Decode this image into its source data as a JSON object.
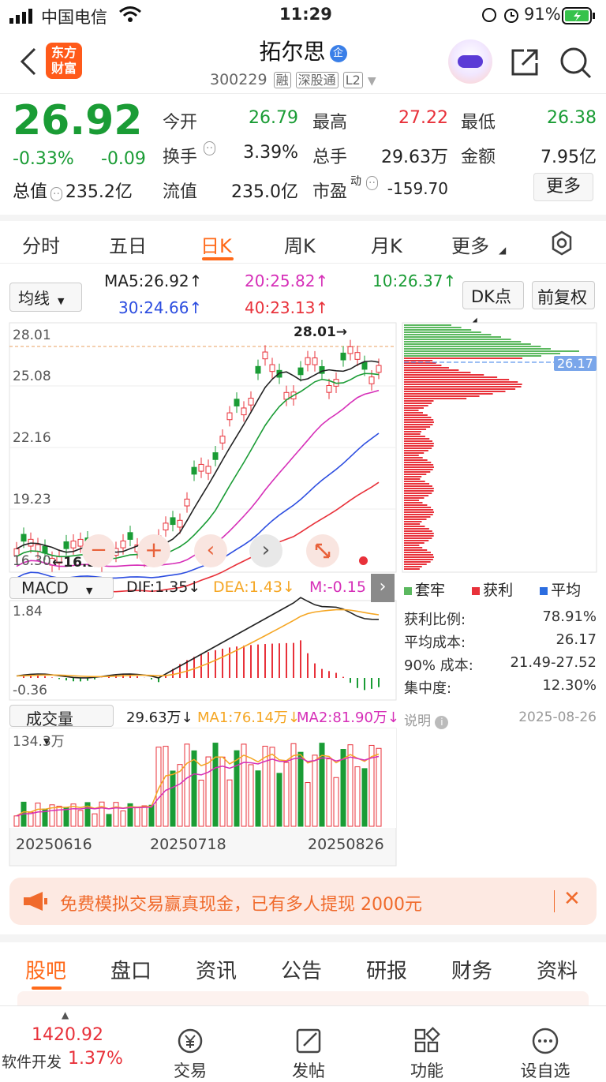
{
  "status": {
    "carrier": "中国电信",
    "time": "11:29",
    "battery": "91%"
  },
  "header": {
    "logo_line1": "东方",
    "logo_line2": "财富",
    "title": "拓尔思",
    "title_badge": "企",
    "code": "300229",
    "tags": [
      "融",
      "深股通",
      "L2"
    ]
  },
  "quote": {
    "price": "26.92",
    "pct": "-0.33%",
    "chg": "-0.09",
    "open_label": "今开",
    "open": "26.79",
    "high_label": "最高",
    "high": "27.22",
    "low_label": "最低",
    "low": "26.38",
    "turnover_label": "换手",
    "turnover": "3.39%",
    "vol_label": "总手",
    "vol": "29.63万",
    "amount_label": "金额",
    "amount": "7.95亿",
    "mcap_label": "总值",
    "mcap": "235.2亿",
    "float_label": "流值",
    "float": "235.0亿",
    "pe_label": "市盈",
    "pe_sup": "动",
    "pe": "-159.70",
    "more": "更多"
  },
  "tabs": [
    "分时",
    "五日",
    "日K",
    "周K",
    "月K",
    "更多"
  ],
  "ma": {
    "selector": "均线",
    "ma5": "MA5:26.92↑",
    "ma10": "10:26.37↑",
    "ma20": "20:25.82↑",
    "ma30": "30:24.66↑",
    "ma40": "40:23.13↑",
    "dk": "DK点",
    "adj": "前复权"
  },
  "kchart": {
    "y_labels": [
      "28.01",
      "25.08",
      "22.16",
      "19.23",
      "16.30"
    ],
    "max_label": "28.01→",
    "min_label": "←16.30"
  },
  "chip": {
    "cost_tag": "26.17",
    "legend": [
      "套牢",
      "获利",
      "平均"
    ],
    "rows": [
      {
        "k": "获利比例:",
        "v": "78.91%"
      },
      {
        "k": "平均成本:",
        "v": "26.17"
      },
      {
        "k": "90% 成本:",
        "v": "21.49-27.52"
      },
      {
        "k": "集中度:",
        "v": "12.30%"
      }
    ],
    "note": "说明",
    "date": "2025-08-26"
  },
  "macd": {
    "selector": "MACD",
    "dif": "DIF:1.35↓",
    "dea": "DEA:1.43↓",
    "m": "M:-0.15",
    "top": "1.84",
    "bottom": "-0.36"
  },
  "vol": {
    "selector": "成交量",
    "v": "29.63万↓",
    "ma1": "MA1:76.14万↓",
    "ma2": "MA2:81.90万↓",
    "top": "134.3万",
    "dates": [
      "20250616",
      "20250718",
      "20250826"
    ]
  },
  "promo": {
    "text": "免费模拟交易赢真现金，已有多人提现 2000元"
  },
  "bottom_tabs": [
    "股吧",
    "盘口",
    "资讯",
    "公告",
    "研报",
    "财务",
    "资料"
  ],
  "bottombar": {
    "index_value": "1420.92",
    "index_name": "软件开发",
    "index_pct": "1.37%",
    "items": [
      "交易",
      "发帖",
      "功能",
      "设自选"
    ]
  },
  "colors": {
    "up": "#e8313a",
    "down": "#1a9c35",
    "accent": "#ff6a1a",
    "blue": "#2c6de0"
  }
}
